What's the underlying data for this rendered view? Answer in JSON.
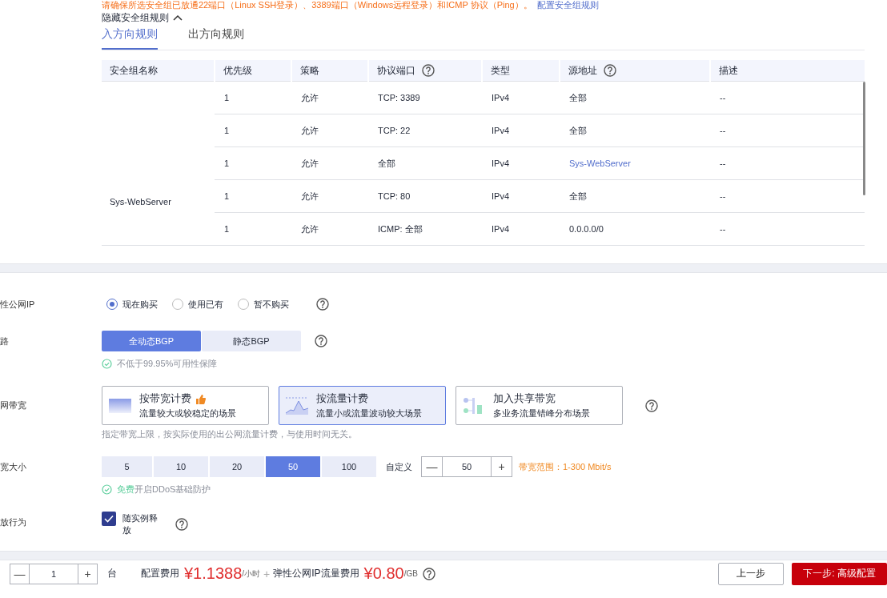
{
  "notice": {
    "text": "请确保所选安全组已放通22端口（Linux SSH登录）、3389端口（Windows远程登录）和ICMP 协议（Ping）。",
    "link": "配置安全组规则"
  },
  "toggle": {
    "label": "隐藏安全组规则",
    "expanded": true
  },
  "tabs": [
    {
      "label": "入方向规则",
      "selected": true
    },
    {
      "label": "出方向规则",
      "selected": false
    }
  ],
  "table": {
    "columns": [
      {
        "label": "安全组名称",
        "help": false
      },
      {
        "label": "优先级",
        "help": false
      },
      {
        "label": "策略",
        "help": false
      },
      {
        "label": "协议端口",
        "help": true
      },
      {
        "label": "类型",
        "help": false
      },
      {
        "label": "源地址",
        "help": true
      },
      {
        "label": "描述",
        "help": false
      }
    ],
    "group": "Sys-WebServer",
    "rows": [
      {
        "priority": "1",
        "policy": "允许",
        "port": "TCP: 3389",
        "type": "IPv4",
        "source": "全部",
        "source_link": false,
        "desc": "--"
      },
      {
        "priority": "1",
        "policy": "允许",
        "port": "TCP: 22",
        "type": "IPv4",
        "source": "全部",
        "source_link": false,
        "desc": "--"
      },
      {
        "priority": "1",
        "policy": "允许",
        "port": "全部",
        "type": "IPv4",
        "source": "Sys-WebServer",
        "source_link": true,
        "desc": "--"
      },
      {
        "priority": "1",
        "policy": "允许",
        "port": "TCP: 80",
        "type": "IPv4",
        "source": "全部",
        "source_link": false,
        "desc": "--"
      },
      {
        "priority": "1",
        "policy": "允许",
        "port": "ICMP: 全部",
        "type": "IPv4",
        "source": "0.0.0.0/0",
        "source_link": false,
        "desc": "--"
      }
    ]
  },
  "form": [
    {
      "kind": "radio",
      "label": "性公网IP",
      "options": [
        {
          "label": "现在购买",
          "selected": true
        },
        {
          "label": "使用已有",
          "selected": false
        },
        {
          "label": "暂不购买",
          "selected": false
        }
      ],
      "help": true
    },
    {
      "kind": "segmented",
      "label": "路",
      "options": [
        {
          "label": "全动态BGP",
          "selected": true
        },
        {
          "label": "静态BGP",
          "selected": false
        }
      ],
      "help": true,
      "note": "不低于99.95%可用性保障"
    },
    {
      "kind": "cards",
      "label": "网带宽",
      "options": [
        {
          "title": "按带宽计费",
          "desc": "流量较大或较稳定的场景",
          "recommended": true,
          "selected": false
        },
        {
          "title": "按流量计费",
          "desc": "流量小或流量波动较大场景",
          "recommended": false,
          "selected": true
        },
        {
          "title": "加入共享带宽",
          "desc": "多业务流量错峰分布场景",
          "recommended": false,
          "selected": false
        }
      ],
      "help": true,
      "hint": "指定带宽上限，按实际使用的出公网流量计费，与使用时间无关。"
    },
    {
      "kind": "sizes",
      "label": "宽大小",
      "options": [
        {
          "label": "5",
          "selected": false
        },
        {
          "label": "10",
          "selected": false
        },
        {
          "label": "20",
          "selected": false
        },
        {
          "label": "50",
          "selected": true
        },
        {
          "label": "100",
          "selected": false
        }
      ],
      "custom_label": "自定义",
      "minus": "—",
      "value": "50",
      "plus": "+",
      "range": "带宽范围：1-300 Mbit/s",
      "note_strong": "免费",
      "note": "开启DDoS基础防护"
    },
    {
      "kind": "checkbox",
      "label": "放行为",
      "checked": true,
      "text": "随实例释放",
      "help": true
    }
  ],
  "footer": {
    "minus": "—",
    "quantity": "1",
    "plus": "+",
    "unit": "台",
    "config_label": "配置费用",
    "config_price": "¥1.1388",
    "config_unit": "/小时",
    "sep": "+",
    "traffic_label": "弹性公网IP流量费用",
    "traffic_price": "¥0.80",
    "traffic_unit": "/GB",
    "prev": "上一步",
    "next": "下一步: 高级配置"
  }
}
